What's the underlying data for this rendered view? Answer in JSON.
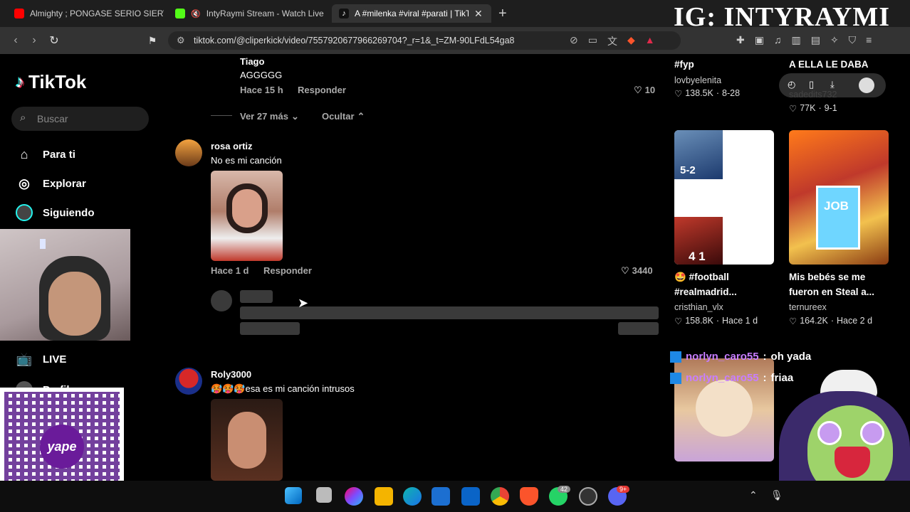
{
  "browser": {
    "tabs": [
      {
        "label": "Almighty ; PONGASE SERIO SIERVO",
        "favicon": "youtube-icon"
      },
      {
        "label": "IntyRaymi Stream - Watch Live on",
        "favicon": "kick-icon"
      },
      {
        "label": "A #milenka #viral #parati | TikTok",
        "favicon": "tiktok-icon"
      }
    ],
    "url": "tiktok.com/@cliperkick/video/7557920677966269704?_r=1&_t=ZM-90LFdL54ga8",
    "new_tab": "+"
  },
  "overlay_watermark": "IG: INTYRAYMI",
  "tiktok": {
    "logo": "TikTok",
    "search_placeholder": "Buscar",
    "nav": [
      {
        "label": "Para ti",
        "icon": "home-icon"
      },
      {
        "label": "Explorar",
        "icon": "compass-icon"
      },
      {
        "label": "Siguiendo",
        "icon": "following-avatar-icon"
      },
      {
        "label": "LIVE",
        "icon": "live-tv-icon"
      },
      {
        "label": "Perfil",
        "icon": "profile-icon"
      }
    ]
  },
  "comments": {
    "top_reply": {
      "user": "Tiago",
      "text": "AGGGGG",
      "time": "Hace 15 h",
      "reply": "Responder",
      "likes": "10"
    },
    "expand": {
      "more": "Ver 27 más",
      "hide": "Ocultar"
    },
    "items": [
      {
        "user": "rosa ortiz",
        "text": "No es mi canción",
        "time": "Hace 1 d",
        "reply": "Responder",
        "likes": "3440"
      },
      {
        "user": "Roly3000",
        "text": "🥵🥵🥵esa es mi canción intrusos"
      }
    ]
  },
  "recommended": {
    "top": [
      {
        "title": "#fyp",
        "user": "lovbyelenita",
        "likes": "138.5K",
        "date": "8-28"
      },
      {
        "title": "A ELLA LE DABA",
        "user": "sadedits732",
        "likes": "77K",
        "date": "9-1"
      }
    ],
    "cards": [
      {
        "title_line1": "🤩 #football",
        "title_line2": "#realmadrid...",
        "user": "cristhian_vlx",
        "likes": "158.8K",
        "date": "Hace 1 d",
        "score1": "5-2",
        "score2": "4 1"
      },
      {
        "title_line1": "Mis bebés se me",
        "title_line2": "fueron en Steal a...",
        "user": "ternureex",
        "likes": "164.2K",
        "date": "Hace 2 d",
        "thumb_text": "JOB"
      }
    ],
    "card_separator": "·"
  },
  "stream_chat": [
    {
      "user": "norlyn_caro55",
      "sep": ":",
      "text": "oh yada"
    },
    {
      "user": "norlyn_caro55",
      "sep": ":",
      "text": "friaa"
    }
  ],
  "qr_label": "yape",
  "taskbar": {
    "badges": {
      "whatsapp": "42",
      "discord": "9+"
    }
  },
  "colors": {
    "accent_pink": "#fe2c55",
    "chat_user": "#c77dff",
    "tab_active": "#333333"
  }
}
